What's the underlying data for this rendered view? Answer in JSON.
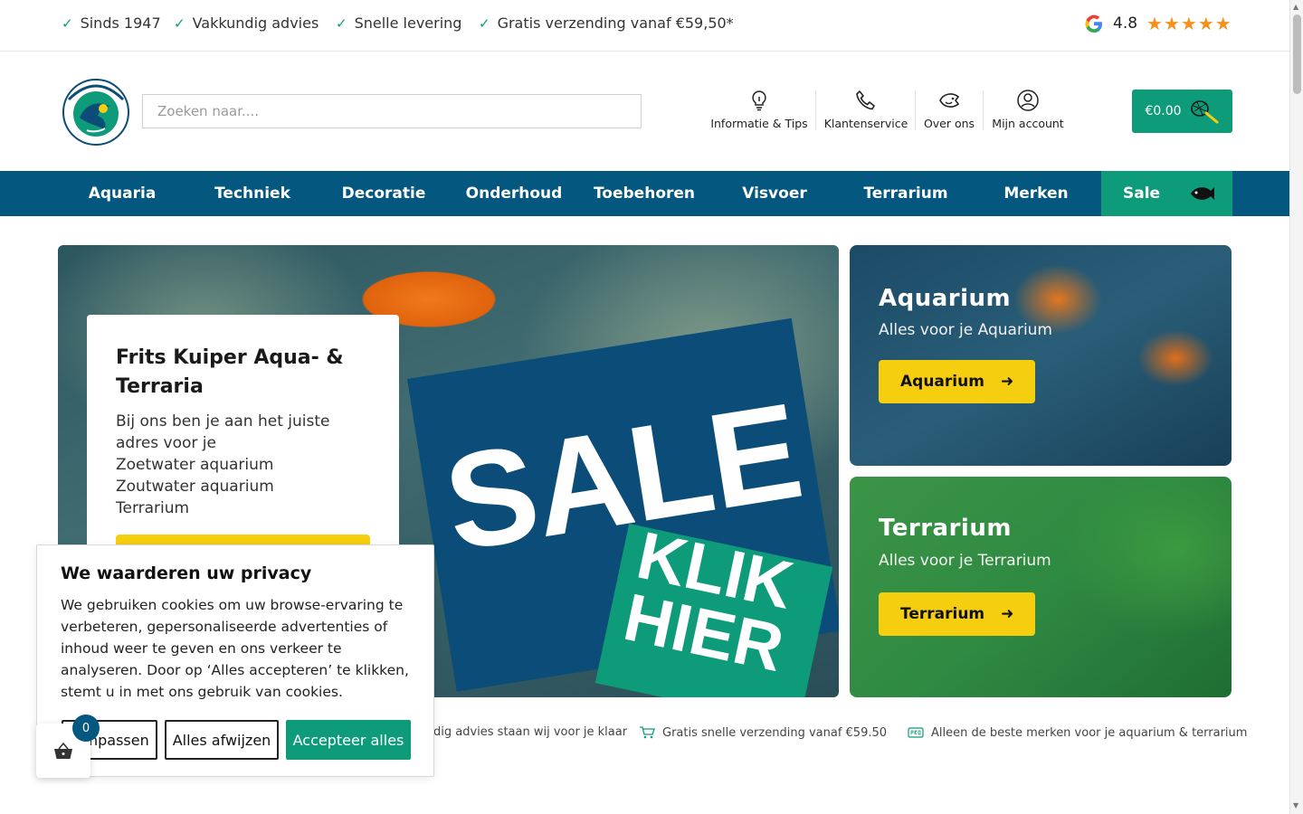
{
  "topbar": {
    "usps": [
      "Sinds 1947",
      "Vakkundig advies",
      "Snelle levering",
      "Gratis verzending vanaf €59,50*"
    ],
    "rating": "4.8",
    "stars": "★★★★★"
  },
  "header": {
    "search_placeholder": "Zoeken naar....",
    "links": [
      "Informatie & Tips",
      "Klantenservice",
      "Over ons",
      "Mijn account"
    ],
    "cart_total": "€0.00"
  },
  "nav": {
    "items": [
      "Aquaria",
      "Techniek",
      "Decoratie",
      "Onderhoud",
      "Toebehoren",
      "Visvoer",
      "Terrarium",
      "Merken"
    ],
    "sale": "Sale"
  },
  "hero": {
    "banner_text": "SALE",
    "banner_cta": "KLIK HIER",
    "card_title": "Frits Kuiper Aqua- & Terraria",
    "card_lines": [
      "Bij ons ben je aan het juiste adres voor je",
      "Zoetwater aquarium",
      "Zoutwater aquarium",
      "Terrarium"
    ]
  },
  "cards": [
    {
      "title": "Aquarium",
      "subtitle": "Alles voor je Aquarium",
      "button": "Aquarium"
    },
    {
      "title": "Terrarium",
      "subtitle": "Alles voor je Terrarium",
      "button": "Terrarium"
    }
  ],
  "usp_row": [
    "dig advies staan wij voor je klaar",
    "Gratis snelle verzending vanaf €59.50",
    "Alleen de beste merken voor je aquarium & terrarium"
  ],
  "cookie": {
    "title": "We waarderen uw privacy",
    "text": "We gebruiken cookies om uw browse-ervaring te verbeteren, gepersonaliseerde advertenties of inhoud weer te geven en ons verkeer te analyseren. Door op ‘Alles accepteren’ te klikken, stemt u in met ons gebruik van cookies.",
    "customize": "Aanpassen",
    "reject": "Alles afwijzen",
    "accept": "Accepteer alles"
  },
  "mini_cart": {
    "count": "0"
  },
  "colors": {
    "brand_blue": "#04577f",
    "brand_green": "#0e9b7a",
    "button_yellow": "#f5cf0f",
    "star_orange": "#f5921e"
  }
}
